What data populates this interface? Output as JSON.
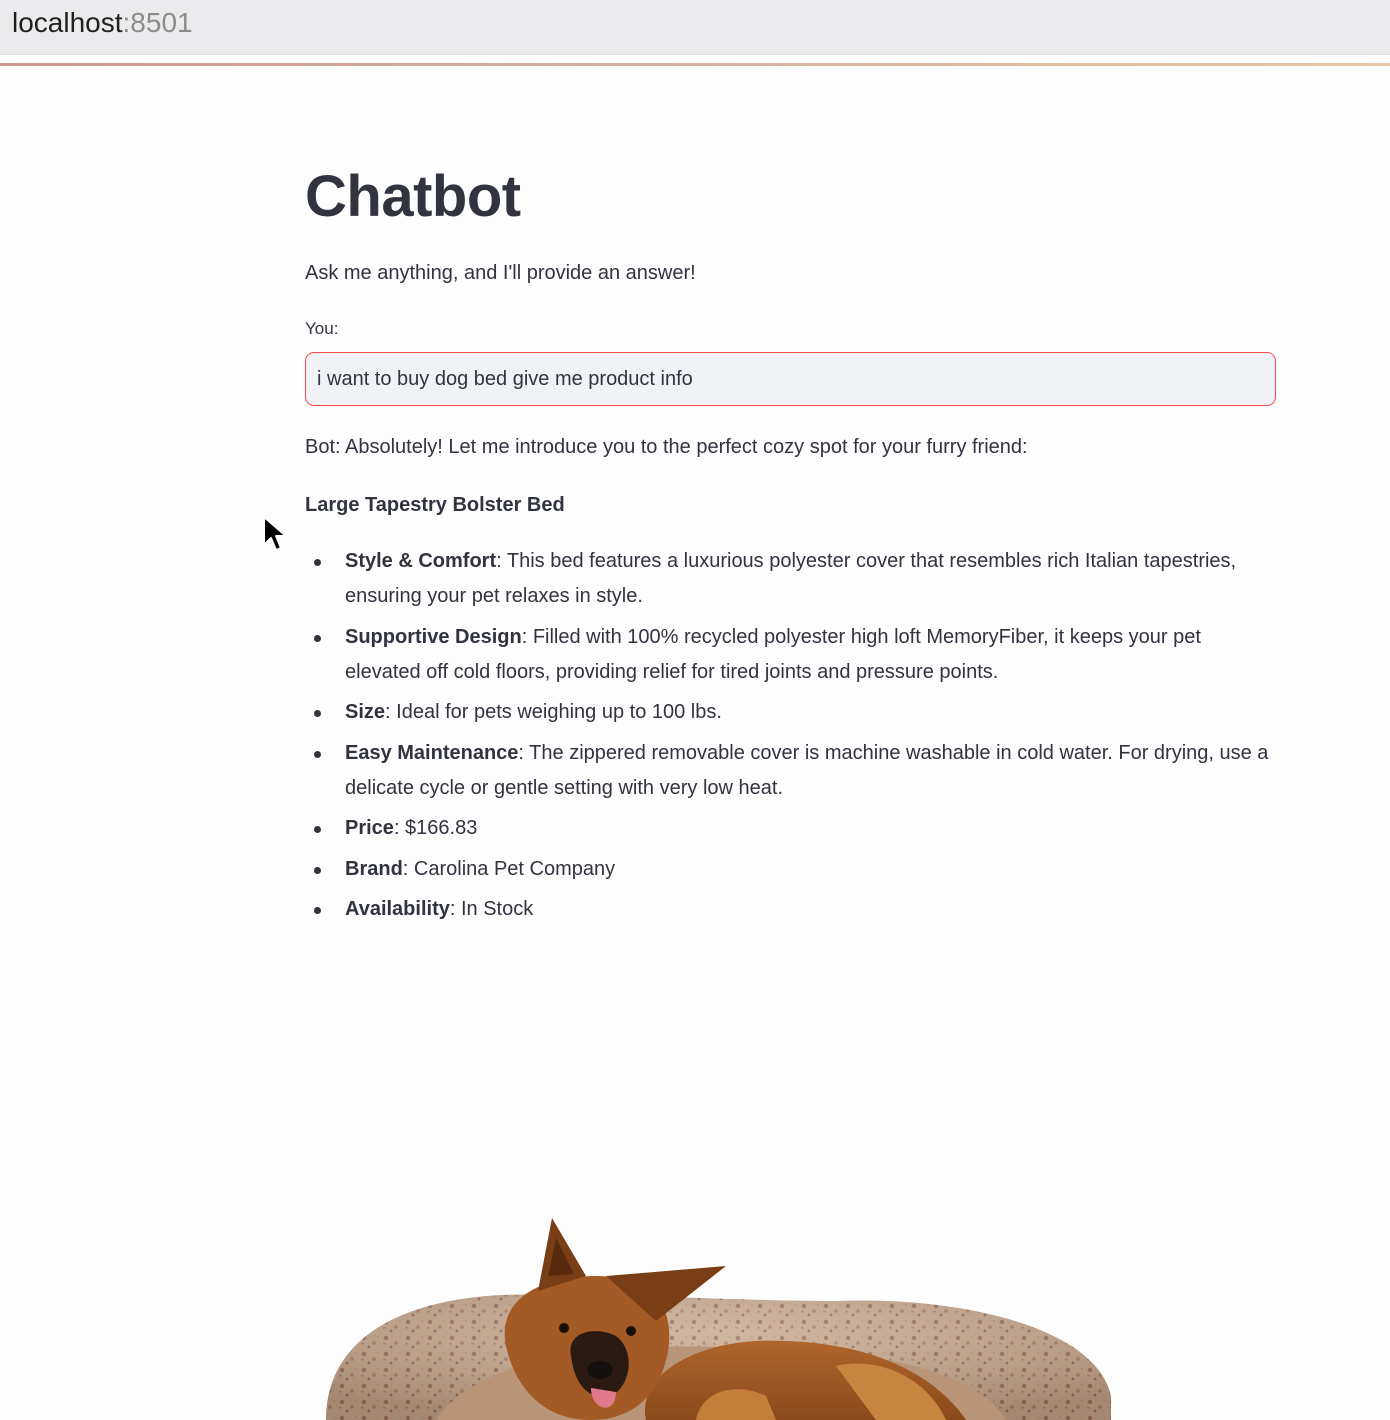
{
  "browser": {
    "host": "localhost",
    "port": ":8501"
  },
  "app": {
    "title": "Chatbot",
    "subtitle": "Ask me anything, and I'll provide an answer!",
    "input": {
      "label": "You:",
      "value": "i want to buy dog bed give me product info"
    },
    "bot_reply": "Bot: Absolutely! Let me introduce you to the perfect cozy spot for your furry friend:",
    "product": {
      "name": "Large Tapestry Bolster Bed",
      "features": [
        {
          "label": "Style & Comfort",
          "text": ": This bed features a luxurious polyester cover that resembles rich Italian tapestries, ensuring your pet relaxes in style."
        },
        {
          "label": "Supportive Design",
          "text": ": Filled with 100% recycled polyester high loft MemoryFiber, it keeps your pet elevated off cold floors, providing relief for tired joints and pressure points."
        },
        {
          "label": "Size",
          "text": ": Ideal for pets weighing up to 100 lbs."
        },
        {
          "label": "Easy Maintenance",
          "text": ": The zippered removable cover is machine washable in cold water. For drying, use a delicate cycle or gentle setting with very low heat."
        },
        {
          "label": "Price",
          "text": ": $166.83"
        },
        {
          "label": "Brand",
          "text": ": Carolina Pet Company"
        },
        {
          "label": "Availability",
          "text": ": In Stock"
        }
      ]
    }
  },
  "colors": {
    "text": "#31333f",
    "input_border": "#ff4b4b",
    "input_bg": "#f0f2f6"
  }
}
